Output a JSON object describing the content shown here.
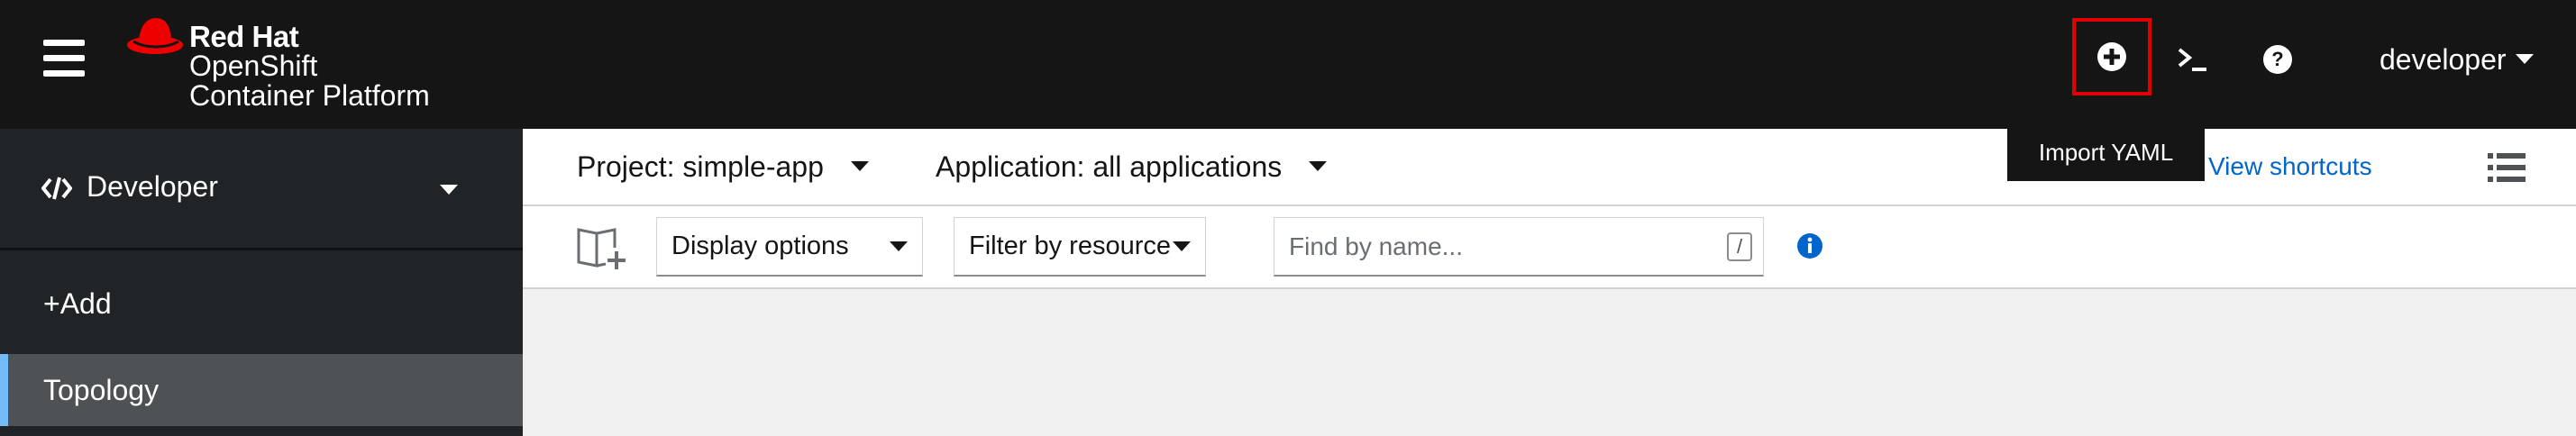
{
  "masthead": {
    "brand": {
      "company": "Red Hat",
      "product_line1": "OpenShift",
      "product_line2": "Container Platform",
      "logo_icon": "red-hat-fedora-icon"
    },
    "tools": {
      "import_icon": "plus-circle-icon",
      "terminal_icon": "terminal-icon",
      "help_icon": "question-circle-icon"
    },
    "user": "developer",
    "tooltip": "Import YAML"
  },
  "sidebar": {
    "perspective": "Developer",
    "items": [
      {
        "label": "+Add",
        "active": false
      },
      {
        "label": "Topology",
        "active": true
      }
    ]
  },
  "context_bar": {
    "project": "Project: simple-app",
    "application": "Application: all applications",
    "view_shortcuts": "View shortcuts"
  },
  "toolbar": {
    "display_options": "Display options",
    "filter_by_resource": "Filter by resource",
    "search_placeholder": "Find by name...",
    "search_shortcut": "/"
  },
  "colors": {
    "masthead_bg": "#151515",
    "sidebar_bg": "#212427",
    "active_item_bg": "#4f5255",
    "active_indicator": "#73bcf7",
    "link": "#0066cc",
    "highlight_box": "#e00000",
    "brand_red": "#ee0000"
  }
}
